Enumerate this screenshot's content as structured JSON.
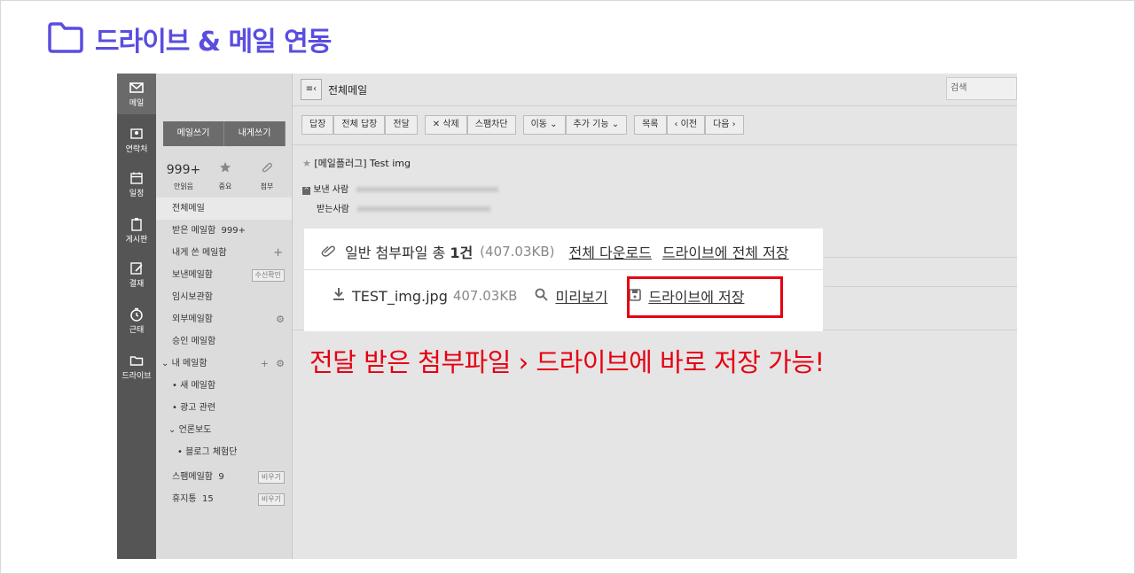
{
  "page": {
    "heading": "드라이브 & 메일 연동",
    "note": "전달 받은 첨부파일 › 드라이브에 바로 저장 가능!",
    "accent_color": "#5a4de0",
    "highlight_color": "#e60012"
  },
  "nav": [
    {
      "label": "메일",
      "icon": "mail-icon"
    },
    {
      "label": "연락처",
      "icon": "contact-icon"
    },
    {
      "label": "일정",
      "icon": "calendar-icon"
    },
    {
      "label": "게시판",
      "icon": "board-icon"
    },
    {
      "label": "결재",
      "icon": "approval-icon"
    },
    {
      "label": "근태",
      "icon": "clock-icon"
    },
    {
      "label": "드라이브",
      "icon": "folder-icon"
    }
  ],
  "panel": {
    "write_mail": "메일쓰기",
    "write_self": "내게쓰기",
    "unread_count": "999+",
    "unread_label": "안읽음",
    "star_label": "중요",
    "attach_label": "첨부",
    "folders": {
      "all": "전체메일",
      "inbox": "받은 메일함",
      "inbox_count": "999+",
      "to_me": "내게 쓴 메일함",
      "sent": "보낸메일함",
      "sent_tag": "수신확인",
      "drafts": "임시보관함",
      "external": "외부메일함",
      "approval": "승인 메일함",
      "my": "내 메일함",
      "new": "새 메일함",
      "ad": "광고 관련",
      "press": "언론보도",
      "blog": "블로그 체험단",
      "spam": "스팸메일함",
      "spam_count": "9",
      "trash": "휴지통",
      "trash_count": "15",
      "empty": "비우기"
    }
  },
  "main": {
    "title": "전체메일",
    "search_placeholder": "검색",
    "toolbar": {
      "reply": "답장",
      "reply_all": "전체 답장",
      "forward": "전달",
      "delete": "✕ 삭제",
      "spam": "스팸차단",
      "move": "이동 ⌄",
      "more": "추가 기능 ⌄",
      "list": "목록",
      "prev": "‹ 이전",
      "next": "다음 ›"
    },
    "subject": "[메일플러그] Test img",
    "from_label": "보낸 사람",
    "to_label": "받는사람"
  },
  "attachment": {
    "label": "일반 첨부파일 총",
    "count": "1건",
    "size": "(407.03KB)",
    "download_all": "전체 다운로드",
    "save_all": "드라이브에 전체 저장",
    "file_name": "TEST_img.jpg",
    "file_size": "407.03KB",
    "preview": "미리보기",
    "save": "드라이브에 저장"
  }
}
